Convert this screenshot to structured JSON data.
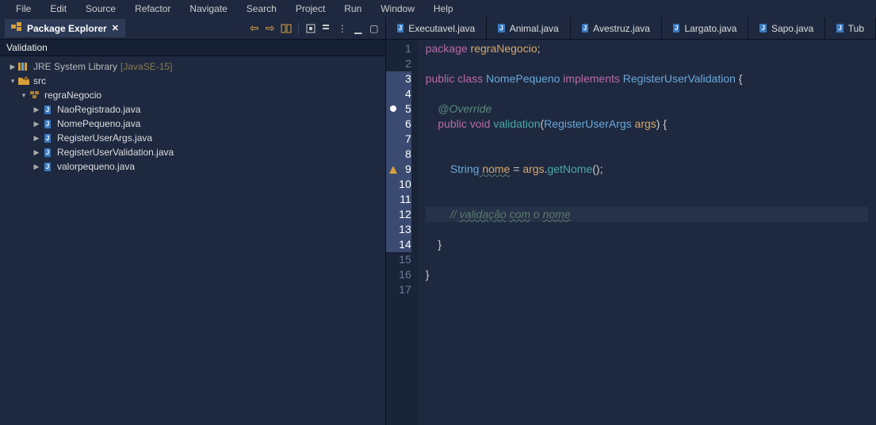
{
  "menu": [
    "File",
    "Edit",
    "Source",
    "Refactor",
    "Navigate",
    "Search",
    "Project",
    "Run",
    "Window",
    "Help"
  ],
  "explorer": {
    "title": "Package Explorer",
    "header": "Validation",
    "jre": {
      "label": "JRE System Library",
      "suffix": "[JavaSE-15]"
    },
    "src": "src",
    "package": "regraNegocio",
    "files": [
      "NaoRegistrado.java",
      "NomePequeno.java",
      "RegisterUserArgs.java",
      "RegisterUserValidation.java",
      "valorpequeno.java"
    ]
  },
  "editorTabs": [
    "Executavel.java",
    "Animal.java",
    "Avestruz.java",
    "Largato.java",
    "Sapo.java",
    "Tub"
  ],
  "code": {
    "l1_kw": "package",
    "l1_pkg": " regraNegocio",
    "l1_end": ";",
    "l3_kw1": "public",
    "l3_kw2": " class",
    "l3_cls": " NomePequeno",
    "l3_kw3": " implements",
    "l3_iface": " RegisterUserValidation",
    "l3_end": " {",
    "l5_ann": "    @Override",
    "l6_kw1": "    public",
    "l6_kw2": " void",
    "l6_mth": " validation",
    "l6_p1": "(",
    "l6_type": "RegisterUserArgs",
    "l6_arg": " args",
    "l6_p2": ") {",
    "l9_type": "        String",
    "l9_var": " nome",
    "l9_eq": " =",
    "l9_obj": " args",
    "l9_dot": ".",
    "l9_call": "getNome",
    "l9_end": "();",
    "l12_cmt1": "        // ",
    "l12_cmt2": "validação",
    "l12_cmt3": " ",
    "l12_cmt4": "com",
    "l12_cmt5": " o ",
    "l12_cmt6": "nome",
    "l14": "    }",
    "l16": "}"
  },
  "lineNumbers": [
    "1",
    "2",
    "3",
    "4",
    "5",
    "6",
    "7",
    "8",
    "9",
    "10",
    "11",
    "12",
    "13",
    "14",
    "15",
    "16",
    "17"
  ]
}
